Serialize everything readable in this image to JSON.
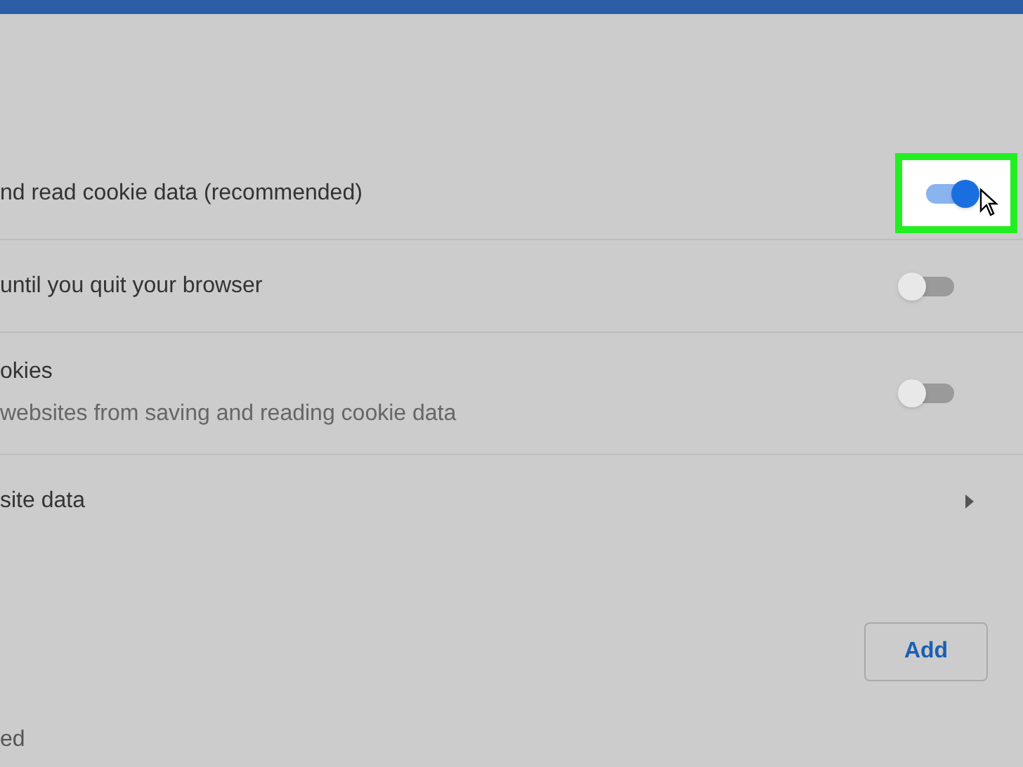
{
  "rows": [
    {
      "kind": "toggle",
      "title": "nd read cookie data (recommended)",
      "on": true,
      "highlighted": true
    },
    {
      "kind": "toggle",
      "title": "until you quit your browser",
      "on": false,
      "highlighted": false
    },
    {
      "kind": "toggle",
      "title": "okies",
      "subtitle": "websites from saving and reading cookie data",
      "on": false,
      "highlighted": false
    },
    {
      "kind": "link",
      "title": "site data"
    }
  ],
  "add_button": "Add",
  "footer_text": "ed"
}
